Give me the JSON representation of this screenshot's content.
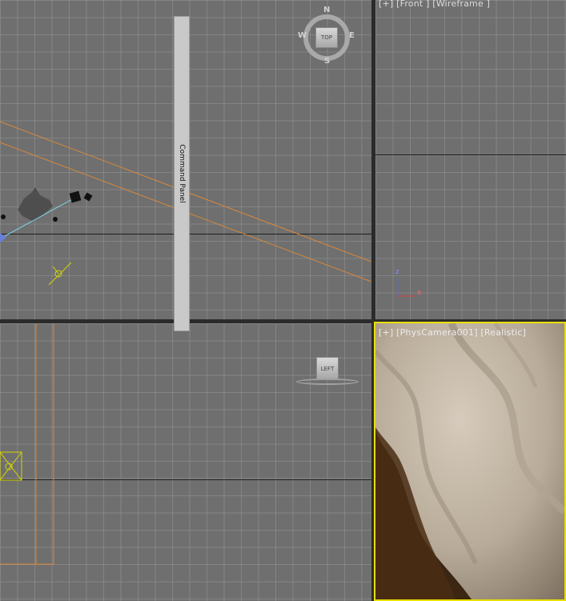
{
  "viewports": {
    "top": {
      "label": ""
    },
    "front": {
      "label": "[+] [Front ] [Wireframe ]"
    },
    "left": {
      "label": ""
    },
    "camera": {
      "label": "[+] [PhysCamera001] [Realistic]"
    }
  },
  "command_panel": {
    "label": "Command Panel"
  },
  "viewcube_top": {
    "face": "TOP",
    "compass": {
      "n": "N",
      "s": "S",
      "e": "E",
      "w": "W"
    }
  },
  "viewcube_left": {
    "face": "LEFT"
  },
  "axis_gizmo": {
    "z": "z",
    "x": "x"
  },
  "colors": {
    "viewport_bg": "#6f6f6f",
    "active_border": "#e8e000",
    "camera_line": "#d88a3c",
    "helper": "#d6d600"
  }
}
